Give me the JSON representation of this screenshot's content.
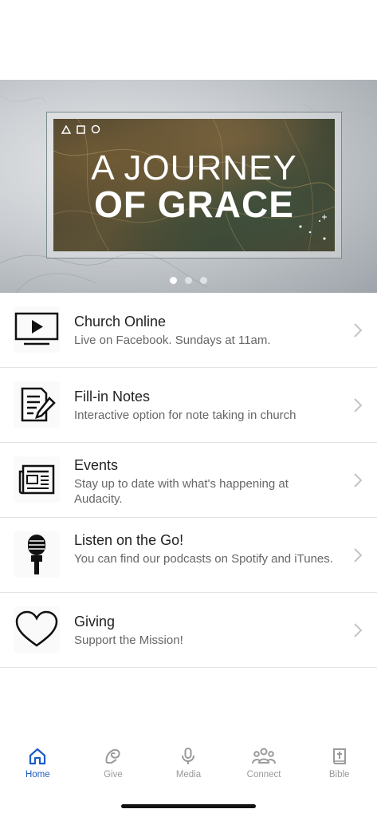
{
  "hero": {
    "title_line1": "A JOURNEY",
    "title_line2": "OF GRACE",
    "slides_total": 3,
    "active_slide": 1
  },
  "menu": [
    {
      "title": "Church Online",
      "subtitle": "Live on Facebook. Sundays at 11am.",
      "icon": "tv-play-icon"
    },
    {
      "title": "Fill-in Notes",
      "subtitle": "Interactive option for note taking in church",
      "icon": "notes-pencil-icon"
    },
    {
      "title": "Events",
      "subtitle": "Stay up to date with what's happening at Audacity.",
      "icon": "newspaper-icon"
    },
    {
      "title": "Listen on the Go!",
      "subtitle": "You can find our podcasts on Spotify and iTunes.",
      "icon": "microphone-icon"
    },
    {
      "title": "Giving",
      "subtitle": "Support the Mission!",
      "icon": "heart-icon"
    }
  ],
  "tabbar": {
    "tabs": [
      {
        "label": "Home",
        "icon": "home-icon",
        "active": true
      },
      {
        "label": "Give",
        "icon": "give-icon",
        "active": false
      },
      {
        "label": "Media",
        "icon": "microphone-icon",
        "active": false
      },
      {
        "label": "Connect",
        "icon": "people-icon",
        "active": false
      },
      {
        "label": "Bible",
        "icon": "bible-icon",
        "active": false
      }
    ]
  },
  "colors": {
    "accent": "#1c5cc4",
    "inactive_tab": "#999999",
    "title_text": "#222222",
    "subtitle_text": "#666666",
    "divider": "#e2e2e2"
  }
}
